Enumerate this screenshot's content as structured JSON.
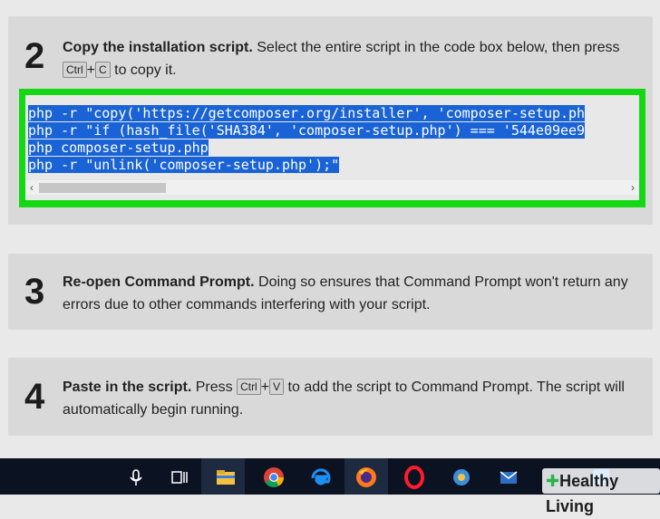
{
  "steps": [
    {
      "number": "2",
      "title": "Copy the installation script.",
      "text_a": " Select the entire script in the code box below, then press ",
      "key1": "Ctrl",
      "plus": "+",
      "key2": "C",
      "text_b": " to copy it.",
      "code_lines": [
        "php -r \"copy('https://getcomposer.org/installer', 'composer-setup.ph",
        "php -r \"if (hash_file('SHA384', 'composer-setup.php') === '544e09ee9",
        "php composer-setup.php",
        "php -r \"unlink('composer-setup.php');\""
      ]
    },
    {
      "number": "3",
      "title": "Re-open Command Prompt.",
      "text": " Doing so ensures that Command Prompt won't return any errors due to other commands interfering with your script."
    },
    {
      "number": "4",
      "title": "Paste in the script.",
      "text_a": " Press ",
      "key1": "Ctrl",
      "plus": "+",
      "key2": "V",
      "text_b": " to add the script to Command Prompt. The script will automatically begin running."
    }
  ],
  "scrollbar": {
    "left_arrow": "‹",
    "right_arrow": "›"
  },
  "watermark": {
    "text": "Healthy Living"
  },
  "taskbar_icons": [
    "microphone-icon",
    "task-view-icon",
    "file-explorer-icon",
    "chrome-icon",
    "edge-icon",
    "firefox-icon",
    "opera-icon",
    "settings-icon",
    "mail-icon",
    "app-icon"
  ]
}
